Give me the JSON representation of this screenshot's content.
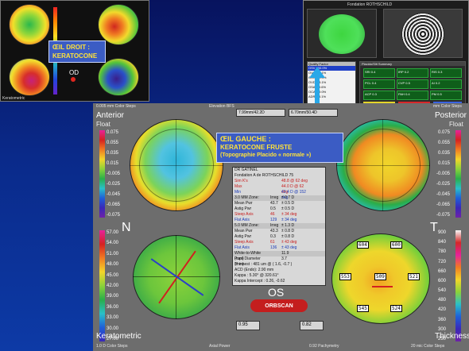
{
  "topleft": {
    "callout_line1": "ŒIL DROIT :",
    "callout_line2": "KERATOCONE",
    "label_od": "OD",
    "footer": "Keratometric"
  },
  "topright": {
    "title": "Fondation ROTHSCHILD",
    "list_header": "Quality Factor",
    "rows": [
      "OSV 100.0%",
      "OVC: 90.1%",
      "OCC: 89.4%",
      "OVD: 88.1%",
      "OSA: 99.6%",
      "OCA: 99.0%",
      "ADR: 98.1%",
      "IAF: 1.67"
    ],
    "hdr_notes": "Placido/Slit Summary",
    "param_title": "Parameter",
    "param_labels": [
      "SRI",
      "IRP",
      "RIS",
      "PCL",
      "CVP",
      "AI",
      "ACP",
      "PAH",
      "PM"
    ],
    "param_values": [
      "0.4",
      "0.2",
      "0.3",
      "0.4",
      "0.5",
      "0.2",
      "0.3",
      "0.4",
      "0.5"
    ],
    "note_title": "Klyce/Maeda Screening",
    "note_text": "Normal topography has the characteristics associated with a normal cornea."
  },
  "main": {
    "top_left_small": "0.005 mm Color Steps",
    "top_center_small": "Elevation BFS",
    "top_right_small": "mm Color Steps",
    "label_anterior": "Anterior",
    "label_float_left": "Float",
    "label_posterior": "Posterior",
    "label_float_right": "Float",
    "label_n": "N",
    "label_t": "T",
    "label_os": "OS",
    "label_keratometric": "Keratometric",
    "label_thickness": "Thickness",
    "footer_left": "1.0 D Color Steps",
    "footer_center_left": "Axial Power",
    "footer_center": "0.92 Pachymetry",
    "footer_right": "20 mic Color Steps",
    "header_box1": "7.99mm/42.2D",
    "header_box2": "6.70mm/50.4D",
    "box_left_bottom": "0.95",
    "box_right_bottom": "0.82",
    "logo": "ORBSCAN"
  },
  "callout_main": {
    "line1": "ŒIL GAUCHE :",
    "line2": "KERATOCONE FRUSTE",
    "line3": "(Topographie Placido « normale »)"
  },
  "scale_left_top": [
    "0.075",
    "0.065",
    "0.055",
    "0.045",
    "0.035",
    "0.025",
    "0.015",
    "0.005",
    "-0.005",
    "-0.015",
    "-0.025",
    "-0.035",
    "-0.045",
    "-0.055",
    "-0.065",
    "-0.075"
  ],
  "scale_left_bottom": [
    "57.00",
    "54.00",
    "51.00",
    "48.00",
    "45.00",
    "42.00",
    "39.00",
    "36.00",
    "33.00",
    "30.00",
    "27.00"
  ],
  "scale_right_top": [
    "0.075",
    "0.065",
    "0.055",
    "0.045",
    "0.035",
    "0.025",
    "0.015",
    "0.005",
    "-0.005",
    "-0.015",
    "-0.025",
    "-0.035",
    "-0.045",
    "-0.055",
    "-0.065",
    "-0.075"
  ],
  "scale_right_bottom": [
    "900",
    "840",
    "780",
    "720",
    "660",
    "600",
    "540",
    "480",
    "420",
    "360",
    "300",
    "250"
  ],
  "table": {
    "title1": "DR GATINEL",
    "title2": "Fondation A de ROTHSCHILD 75",
    "rows": [
      {
        "a": "Sim K's",
        "b": "",
        "c": "48.8 @ 62 deg",
        "cls": "red"
      },
      {
        "a": "Max",
        "b": "",
        "c": "44.0 D @ 62 deg",
        "cls": "red"
      },
      {
        "a": "Min",
        "b": "",
        "c": "43.4 D @ 152 deg",
        "cls": "blue"
      },
      {
        "a": "3.0 MM Zone:",
        "b": "Irreg",
        "c": "± 0.7 D",
        "cls": "sec"
      },
      {
        "a": "Mean Pwr",
        "b": "43.7",
        "c": "± 0.5 D",
        "cls": ""
      },
      {
        "a": "Astig Pwr",
        "b": "0.5",
        "c": "± 0.5 D",
        "cls": ""
      },
      {
        "a": "Steep Axis",
        "b": "46",
        "c": "± 34 deg",
        "cls": "red"
      },
      {
        "a": "Flat Axis",
        "b": "129",
        "c": "± 34 deg",
        "cls": "blue"
      },
      {
        "a": "5.0 MM Zone:",
        "b": "Irreg",
        "c": "± 1.3 D",
        "cls": "sec"
      },
      {
        "a": "Mean Pwr",
        "b": "43.3",
        "c": "± 0.8 D",
        "cls": ""
      },
      {
        "a": "Astig Pwr",
        "b": "0.3",
        "c": "± 0.8 D",
        "cls": ""
      },
      {
        "a": "Steep Axis",
        "b": "61",
        "c": "± 43 deg",
        "cls": "red"
      },
      {
        "a": "Flat Axis",
        "b": "136",
        "c": "± 43 deg",
        "cls": "blue"
      },
      {
        "a": "White-to-White (mm)",
        "b": "",
        "c": "11.9",
        "cls": "sec"
      },
      {
        "a": "Pupil Diameter (mm)",
        "b": "",
        "c": "3.7",
        "cls": ""
      },
      {
        "a": "Thinnest : 481 um @ ( 1.6, -0.7 )",
        "b": "",
        "c": "",
        "cls": ""
      },
      {
        "a": "ACD (Endo): 2.90 mm",
        "b": "",
        "c": "",
        "cls": ""
      },
      {
        "a": "Kappa : 5.30° @ 320.61°",
        "b": "",
        "c": "",
        "cls": ""
      },
      {
        "a": "Kappa Intercept : 0.26, -0.62",
        "b": "",
        "c": "",
        "cls": ""
      }
    ]
  },
  "pachy": {
    "top_left": "604",
    "top_right": "600",
    "left": "553",
    "center": "509",
    "right": "521",
    "bottom_left": "545",
    "bottom_right": "524"
  }
}
